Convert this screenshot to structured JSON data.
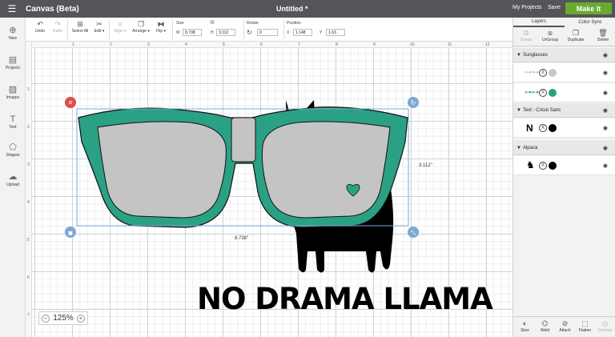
{
  "header": {
    "menu_icon": "hamburger-icon",
    "app_title": "Canvas (Beta)",
    "doc_title": "Untitled *",
    "my_projects": "My Projects",
    "save": "Save",
    "make_it": "Make It",
    "colors": {
      "bar": "#535559",
      "make_it": "#6aa92f"
    }
  },
  "toolbar": {
    "undo": "Undo",
    "redo": "Redo",
    "select_all": "Select All",
    "edit": "Edit",
    "align": "Align",
    "arrange": "Arrange",
    "flip": "Flip",
    "size_label": "Size",
    "w_label": "W",
    "w_value": "8.738",
    "h_label": "H",
    "h_value": "3.112",
    "rotate_label": "Rotate",
    "rotate_value": "0",
    "position_label": "Position",
    "x_label": "X",
    "x_value": "1.148",
    "y_label": "Y",
    "y_value": "1.63"
  },
  "leftbar": {
    "items": [
      {
        "label": "New",
        "icon": "plus-circle-icon"
      },
      {
        "label": "Projects",
        "icon": "projects-icon"
      },
      {
        "label": "Images",
        "icon": "image-icon"
      },
      {
        "label": "Text",
        "icon": "text-icon"
      },
      {
        "label": "Shapes",
        "icon": "shapes-icon"
      },
      {
        "label": "Upload",
        "icon": "upload-icon"
      }
    ]
  },
  "ruler": {
    "top": [
      "1",
      "2",
      "3",
      "4",
      "5",
      "6",
      "7",
      "8",
      "9",
      "10",
      "11",
      "12"
    ],
    "left": [
      "1",
      "2",
      "3",
      "4",
      "5",
      "6",
      "7"
    ]
  },
  "canvas": {
    "width_measure": "8.738\"",
    "height_measure": "3.112\"",
    "slogan": "NO DRAMA LLAMA",
    "colors": {
      "glasses": "#2aa184",
      "lens": "#c4c4c4",
      "llama": "#000000",
      "selection": "#7fa8d4",
      "delete": "#e04a4a"
    }
  },
  "zoom": {
    "minus": "−",
    "value": "125%",
    "plus": "+"
  },
  "panel": {
    "tabs": [
      "Layers",
      "Color Sync"
    ],
    "tools": {
      "group": "Group",
      "ungroup": "UnGroup",
      "duplicate": "Duplicate",
      "delete": "Delete"
    },
    "groups": [
      {
        "name": "Sunglasses"
      },
      {
        "name": "Text - Cricut Sans"
      },
      {
        "name": "Alpaca"
      }
    ],
    "layer_colors": {
      "sunglasses_1": "#c8c8c8",
      "sunglasses_2": "#2aa184",
      "text": "#000000",
      "alpaca": "#000000"
    },
    "bottom": {
      "slice": "Slice",
      "weld": "Weld",
      "attach": "Attach",
      "flatten": "Flatten",
      "contour": "Contour"
    }
  }
}
